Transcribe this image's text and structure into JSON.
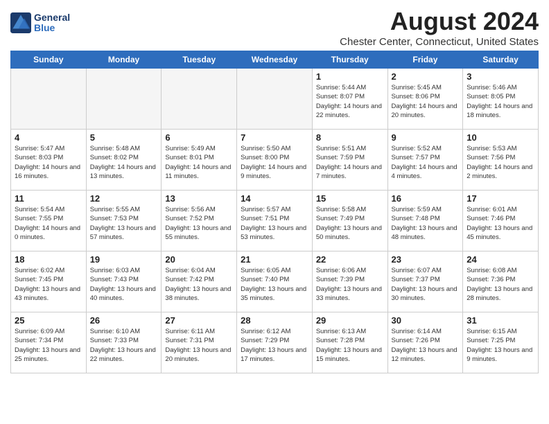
{
  "header": {
    "logo_line1": "General",
    "logo_line2": "Blue",
    "title": "August 2024",
    "subtitle": "Chester Center, Connecticut, United States"
  },
  "days_of_week": [
    "Sunday",
    "Monday",
    "Tuesday",
    "Wednesday",
    "Thursday",
    "Friday",
    "Saturday"
  ],
  "weeks": [
    [
      {
        "day": "",
        "info": ""
      },
      {
        "day": "",
        "info": ""
      },
      {
        "day": "",
        "info": ""
      },
      {
        "day": "",
        "info": ""
      },
      {
        "day": "1",
        "info": "Sunrise: 5:44 AM\nSunset: 8:07 PM\nDaylight: 14 hours\nand 22 minutes."
      },
      {
        "day": "2",
        "info": "Sunrise: 5:45 AM\nSunset: 8:06 PM\nDaylight: 14 hours\nand 20 minutes."
      },
      {
        "day": "3",
        "info": "Sunrise: 5:46 AM\nSunset: 8:05 PM\nDaylight: 14 hours\nand 18 minutes."
      }
    ],
    [
      {
        "day": "4",
        "info": "Sunrise: 5:47 AM\nSunset: 8:03 PM\nDaylight: 14 hours\nand 16 minutes."
      },
      {
        "day": "5",
        "info": "Sunrise: 5:48 AM\nSunset: 8:02 PM\nDaylight: 14 hours\nand 13 minutes."
      },
      {
        "day": "6",
        "info": "Sunrise: 5:49 AM\nSunset: 8:01 PM\nDaylight: 14 hours\nand 11 minutes."
      },
      {
        "day": "7",
        "info": "Sunrise: 5:50 AM\nSunset: 8:00 PM\nDaylight: 14 hours\nand 9 minutes."
      },
      {
        "day": "8",
        "info": "Sunrise: 5:51 AM\nSunset: 7:59 PM\nDaylight: 14 hours\nand 7 minutes."
      },
      {
        "day": "9",
        "info": "Sunrise: 5:52 AM\nSunset: 7:57 PM\nDaylight: 14 hours\nand 4 minutes."
      },
      {
        "day": "10",
        "info": "Sunrise: 5:53 AM\nSunset: 7:56 PM\nDaylight: 14 hours\nand 2 minutes."
      }
    ],
    [
      {
        "day": "11",
        "info": "Sunrise: 5:54 AM\nSunset: 7:55 PM\nDaylight: 14 hours\nand 0 minutes."
      },
      {
        "day": "12",
        "info": "Sunrise: 5:55 AM\nSunset: 7:53 PM\nDaylight: 13 hours\nand 57 minutes."
      },
      {
        "day": "13",
        "info": "Sunrise: 5:56 AM\nSunset: 7:52 PM\nDaylight: 13 hours\nand 55 minutes."
      },
      {
        "day": "14",
        "info": "Sunrise: 5:57 AM\nSunset: 7:51 PM\nDaylight: 13 hours\nand 53 minutes."
      },
      {
        "day": "15",
        "info": "Sunrise: 5:58 AM\nSunset: 7:49 PM\nDaylight: 13 hours\nand 50 minutes."
      },
      {
        "day": "16",
        "info": "Sunrise: 5:59 AM\nSunset: 7:48 PM\nDaylight: 13 hours\nand 48 minutes."
      },
      {
        "day": "17",
        "info": "Sunrise: 6:01 AM\nSunset: 7:46 PM\nDaylight: 13 hours\nand 45 minutes."
      }
    ],
    [
      {
        "day": "18",
        "info": "Sunrise: 6:02 AM\nSunset: 7:45 PM\nDaylight: 13 hours\nand 43 minutes."
      },
      {
        "day": "19",
        "info": "Sunrise: 6:03 AM\nSunset: 7:43 PM\nDaylight: 13 hours\nand 40 minutes."
      },
      {
        "day": "20",
        "info": "Sunrise: 6:04 AM\nSunset: 7:42 PM\nDaylight: 13 hours\nand 38 minutes."
      },
      {
        "day": "21",
        "info": "Sunrise: 6:05 AM\nSunset: 7:40 PM\nDaylight: 13 hours\nand 35 minutes."
      },
      {
        "day": "22",
        "info": "Sunrise: 6:06 AM\nSunset: 7:39 PM\nDaylight: 13 hours\nand 33 minutes."
      },
      {
        "day": "23",
        "info": "Sunrise: 6:07 AM\nSunset: 7:37 PM\nDaylight: 13 hours\nand 30 minutes."
      },
      {
        "day": "24",
        "info": "Sunrise: 6:08 AM\nSunset: 7:36 PM\nDaylight: 13 hours\nand 28 minutes."
      }
    ],
    [
      {
        "day": "25",
        "info": "Sunrise: 6:09 AM\nSunset: 7:34 PM\nDaylight: 13 hours\nand 25 minutes."
      },
      {
        "day": "26",
        "info": "Sunrise: 6:10 AM\nSunset: 7:33 PM\nDaylight: 13 hours\nand 22 minutes."
      },
      {
        "day": "27",
        "info": "Sunrise: 6:11 AM\nSunset: 7:31 PM\nDaylight: 13 hours\nand 20 minutes."
      },
      {
        "day": "28",
        "info": "Sunrise: 6:12 AM\nSunset: 7:29 PM\nDaylight: 13 hours\nand 17 minutes."
      },
      {
        "day": "29",
        "info": "Sunrise: 6:13 AM\nSunset: 7:28 PM\nDaylight: 13 hours\nand 15 minutes."
      },
      {
        "day": "30",
        "info": "Sunrise: 6:14 AM\nSunset: 7:26 PM\nDaylight: 13 hours\nand 12 minutes."
      },
      {
        "day": "31",
        "info": "Sunrise: 6:15 AM\nSunset: 7:25 PM\nDaylight: 13 hours\nand 9 minutes."
      }
    ]
  ]
}
